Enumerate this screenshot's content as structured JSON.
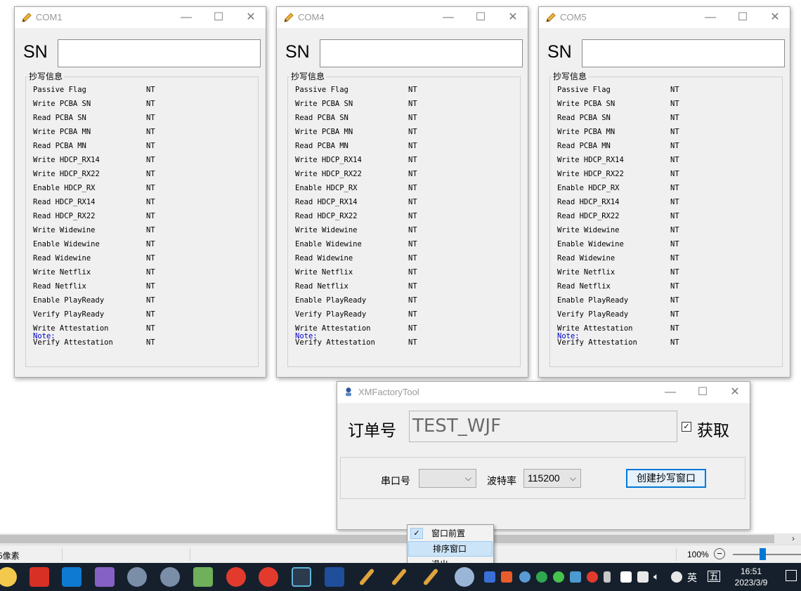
{
  "com_windows": [
    {
      "title": "COM1",
      "sn_label": "SN",
      "group_title": "抄写信息",
      "note": "Note:"
    },
    {
      "title": "COM4",
      "sn_label": "SN",
      "group_title": "抄写信息",
      "note": "Note:"
    },
    {
      "title": "COM5",
      "sn_label": "SN",
      "group_title": "抄写信息",
      "note": "Note:"
    }
  ],
  "items": [
    {
      "label": "Passive Flag",
      "value": "NT"
    },
    {
      "label": "Write PCBA SN",
      "value": "NT"
    },
    {
      "label": "Read PCBA SN",
      "value": "NT"
    },
    {
      "label": "Write PCBA MN",
      "value": "NT"
    },
    {
      "label": "Read PCBA MN",
      "value": "NT"
    },
    {
      "label": "Write HDCP_RX14",
      "value": "NT"
    },
    {
      "label": "Write HDCP_RX22",
      "value": "NT"
    },
    {
      "label": "Enable HDCP_RX",
      "value": "NT"
    },
    {
      "label": "Read HDCP_RX14",
      "value": "NT"
    },
    {
      "label": "Read HDCP_RX22",
      "value": "NT"
    },
    {
      "label": "Write Widewine",
      "value": "NT"
    },
    {
      "label": "Enable Widewine",
      "value": "NT"
    },
    {
      "label": "Read Widewine",
      "value": "NT"
    },
    {
      "label": "Write Netflix",
      "value": "NT"
    },
    {
      "label": "Read Netflix",
      "value": "NT"
    },
    {
      "label": "Enable PlayReady",
      "value": "NT"
    },
    {
      "label": "Verify PlayReady",
      "value": "NT"
    },
    {
      "label": "Write Attestation",
      "value": "NT"
    },
    {
      "label": "Verify Attestation",
      "value": "NT"
    }
  ],
  "tool": {
    "title": "XMFactoryTool",
    "order_label": "订单号",
    "order_value": "TEST_WJF",
    "fetch_label": "获取",
    "fetch_checked": true,
    "port_label": "串口号",
    "port_value": "",
    "baud_label": "波特率",
    "baud_value": "115200",
    "create_button": "创建抄写窗口"
  },
  "context_menu": {
    "items": [
      {
        "label": "窗口前置",
        "checked": true
      },
      {
        "label": "排序窗口",
        "highlighted": true
      },
      {
        "label": "退出"
      }
    ]
  },
  "statusbar": {
    "left_text": "5像素",
    "zoom": "100%"
  },
  "taskbar": {
    "time": "16:51",
    "date": "2023/3/9",
    "ime": "英",
    "ime2": "五"
  },
  "colors": {
    "accent": "#0078d7",
    "note": "#0000cc",
    "taskbar": "#16202d"
  }
}
